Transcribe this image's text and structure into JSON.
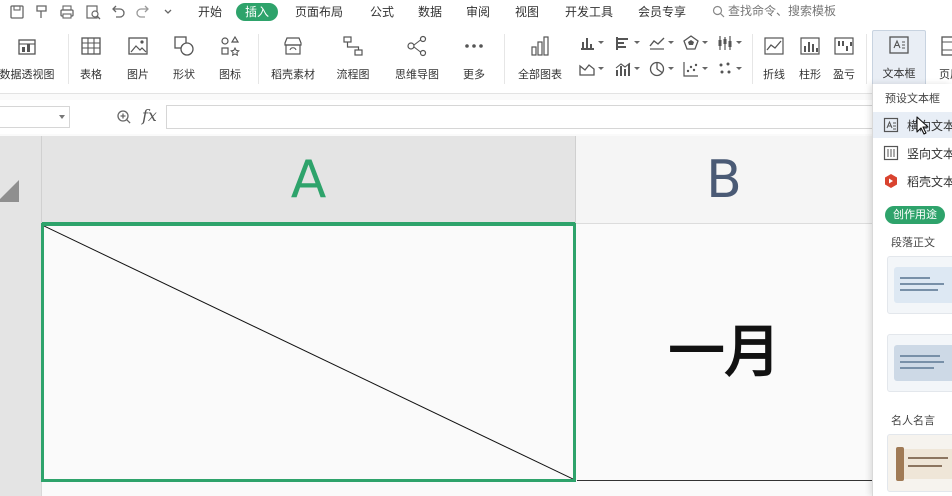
{
  "menubar": {
    "tabs": [
      "开始",
      "插入",
      "页面布局",
      "公式",
      "数据",
      "审阅",
      "视图",
      "开发工具",
      "会员专享"
    ],
    "active_tab": "插入",
    "search_placeholder": "查找命令、搜索模板"
  },
  "ribbon": {
    "pivot_label": "数据透视图",
    "table_label": "表格",
    "picture_label": "图片",
    "shape_label": "形状",
    "icon_label": "图标",
    "docer_material_label": "稻壳素材",
    "flowchart_label": "流程图",
    "mindmap_label": "思维导图",
    "more_label": "更多",
    "all_charts_label": "全部图表",
    "line_label": "折线",
    "column_label": "柱形",
    "winloss_label": "盈亏",
    "textbox_label": "文本框",
    "header_footer_label": "页眉"
  },
  "formula_bar": {
    "fx_label": "fx",
    "name_box_value": "",
    "formula_value": ""
  },
  "grid": {
    "col_a_label": "A",
    "col_b_label": "B",
    "cell_b1_value": "一月"
  },
  "textbox_dropdown": {
    "section_title": "预设文本框",
    "items": [
      "横向文本",
      "竖向文本",
      "稻壳文本"
    ],
    "usage_tag": "创作用途",
    "category_paragraph": "段落正文",
    "category_quotes": "名人名言"
  },
  "colors": {
    "accent_green": "#2ea36b",
    "column_b_text": "#4a5a75",
    "docer_red": "#d9432f"
  }
}
